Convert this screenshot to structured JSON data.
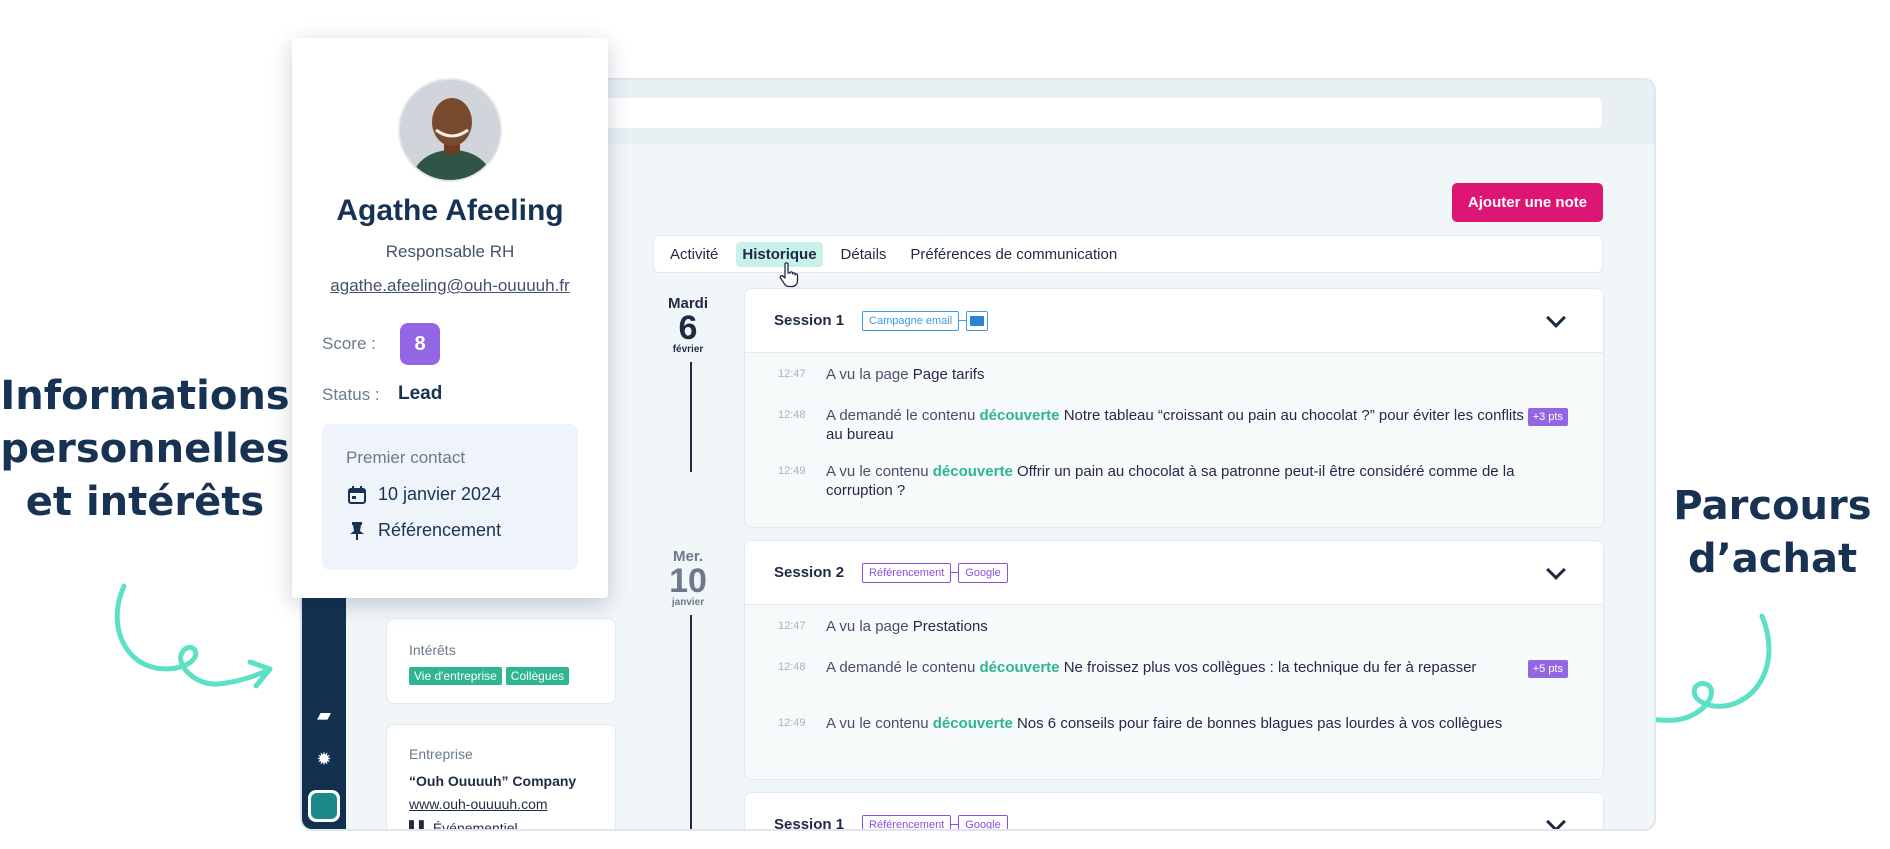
{
  "annotations": {
    "left": [
      "Informations",
      "personnelles",
      "et intérêts"
    ],
    "right": [
      "Parcours",
      "d’achat"
    ]
  },
  "colors": {
    "brand_pink": "#dc1672",
    "keyword_green": "#2fb58f",
    "purple": "#9366e6",
    "navy": "#14304f",
    "annotation_navy": "#173253",
    "arrow_teal": "#5ce0c6",
    "tag_blue": "#3b9be6",
    "tag_purple": "#8b4fe0"
  },
  "profile": {
    "name": "Agathe Afeeling",
    "role": "Responsable RH",
    "email": "agathe.afeeling@ouh-ouuuuh.fr",
    "score_label": "Score :",
    "score_value": "8",
    "status_label": "Status :",
    "status_value": "Lead",
    "first_contact": {
      "title": "Premier contact",
      "date_icon": "calendar-icon",
      "date": "10 janvier 2024",
      "source_icon": "pin-icon",
      "source": "Référencement"
    }
  },
  "left_column": {
    "interests": {
      "title": "Intérêts",
      "tags": [
        "Vie d'entreprise",
        "Collègues"
      ]
    },
    "company": {
      "title": "Entreprise",
      "name": "“Ouh Ouuuuh” Company",
      "website": "www.ouh-ouuuuh.com",
      "sector_partial": "Événementiel"
    }
  },
  "sidebar": {
    "icons": [
      "folder-icon",
      "gear-icon",
      "app-logo-icon"
    ]
  },
  "main": {
    "add_note_label": "Ajouter une note",
    "tabs": [
      {
        "label": "Activité",
        "active": false
      },
      {
        "label": "Historique",
        "active": true
      },
      {
        "label": "Détails",
        "active": false
      },
      {
        "label": "Préférences de communication",
        "active": false
      }
    ],
    "days": [
      {
        "name": "Mardi",
        "num": "6",
        "month": "février"
      },
      {
        "name": "Mer.",
        "num": "10",
        "month": "janvier"
      }
    ],
    "sessions": [
      {
        "title": "Session 1",
        "tag_1": "Campagne email",
        "tag_icon": "mail-icon",
        "events": [
          {
            "time": "12:47",
            "pre": "A vu la page",
            "kw": "",
            "obj": "Page tarifs",
            "pts": ""
          },
          {
            "time": "12:48",
            "pre": "A demandé le contenu",
            "kw": "découverte",
            "obj": "Notre tableau “croissant ou pain au chocolat ?” pour éviter les conflits au bureau",
            "pts": "+3 pts"
          },
          {
            "time": "12:49",
            "pre": "A vu le contenu",
            "kw": "découverte",
            "obj": "Offrir un pain au chocolat à sa patronne peut-il être considéré comme de la corruption ?",
            "pts": ""
          }
        ]
      },
      {
        "title": "Session 2",
        "tag_1": "Référencement",
        "tag_2": "Google",
        "events": [
          {
            "time": "12:47",
            "pre": "A vu la page",
            "kw": "",
            "obj": "Prestations",
            "pts": ""
          },
          {
            "time": "12:48",
            "pre": "A demandé le contenu",
            "kw": "découverte",
            "obj": "Ne froissez plus vos collègues : la technique du fer à repasser",
            "pts": "+5 pts"
          },
          {
            "time": "12:49",
            "pre": "A vu le contenu",
            "kw": "découverte",
            "obj": "Nos 6 conseils pour faire de bonnes blagues pas lourdes à vos collègues",
            "pts": ""
          }
        ]
      },
      {
        "title": "Session 1",
        "tag_1": "Référencement",
        "tag_2": "Google"
      }
    ]
  }
}
